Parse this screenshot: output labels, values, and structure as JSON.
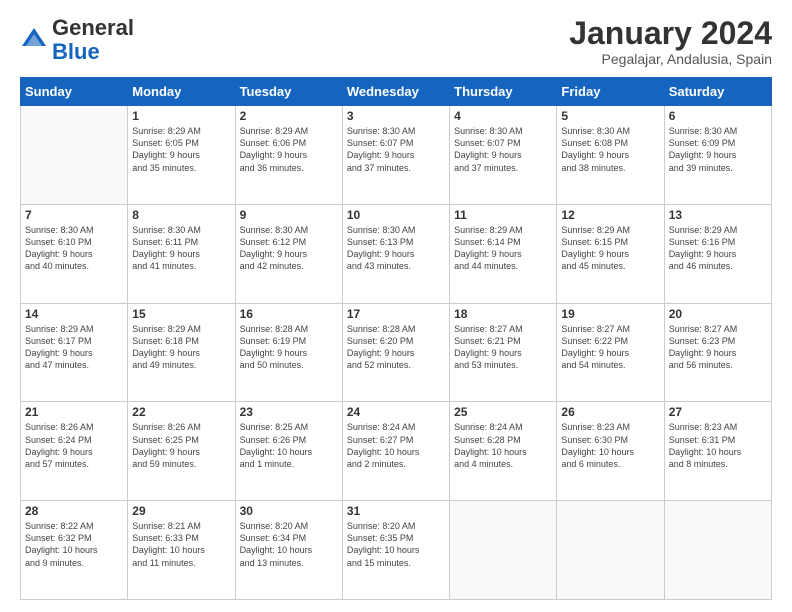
{
  "header": {
    "logo_general": "General",
    "logo_blue": "Blue",
    "month_year": "January 2024",
    "location": "Pegalajar, Andalusia, Spain"
  },
  "weekdays": [
    "Sunday",
    "Monday",
    "Tuesday",
    "Wednesday",
    "Thursday",
    "Friday",
    "Saturday"
  ],
  "weeks": [
    [
      {
        "day": null,
        "info": null
      },
      {
        "day": "1",
        "info": "Sunrise: 8:29 AM\nSunset: 6:05 PM\nDaylight: 9 hours\nand 35 minutes."
      },
      {
        "day": "2",
        "info": "Sunrise: 8:29 AM\nSunset: 6:06 PM\nDaylight: 9 hours\nand 36 minutes."
      },
      {
        "day": "3",
        "info": "Sunrise: 8:30 AM\nSunset: 6:07 PM\nDaylight: 9 hours\nand 37 minutes."
      },
      {
        "day": "4",
        "info": "Sunrise: 8:30 AM\nSunset: 6:07 PM\nDaylight: 9 hours\nand 37 minutes."
      },
      {
        "day": "5",
        "info": "Sunrise: 8:30 AM\nSunset: 6:08 PM\nDaylight: 9 hours\nand 38 minutes."
      },
      {
        "day": "6",
        "info": "Sunrise: 8:30 AM\nSunset: 6:09 PM\nDaylight: 9 hours\nand 39 minutes."
      }
    ],
    [
      {
        "day": "7",
        "info": "Sunrise: 8:30 AM\nSunset: 6:10 PM\nDaylight: 9 hours\nand 40 minutes."
      },
      {
        "day": "8",
        "info": "Sunrise: 8:30 AM\nSunset: 6:11 PM\nDaylight: 9 hours\nand 41 minutes."
      },
      {
        "day": "9",
        "info": "Sunrise: 8:30 AM\nSunset: 6:12 PM\nDaylight: 9 hours\nand 42 minutes."
      },
      {
        "day": "10",
        "info": "Sunrise: 8:30 AM\nSunset: 6:13 PM\nDaylight: 9 hours\nand 43 minutes."
      },
      {
        "day": "11",
        "info": "Sunrise: 8:29 AM\nSunset: 6:14 PM\nDaylight: 9 hours\nand 44 minutes."
      },
      {
        "day": "12",
        "info": "Sunrise: 8:29 AM\nSunset: 6:15 PM\nDaylight: 9 hours\nand 45 minutes."
      },
      {
        "day": "13",
        "info": "Sunrise: 8:29 AM\nSunset: 6:16 PM\nDaylight: 9 hours\nand 46 minutes."
      }
    ],
    [
      {
        "day": "14",
        "info": "Sunrise: 8:29 AM\nSunset: 6:17 PM\nDaylight: 9 hours\nand 47 minutes."
      },
      {
        "day": "15",
        "info": "Sunrise: 8:29 AM\nSunset: 6:18 PM\nDaylight: 9 hours\nand 49 minutes."
      },
      {
        "day": "16",
        "info": "Sunrise: 8:28 AM\nSunset: 6:19 PM\nDaylight: 9 hours\nand 50 minutes."
      },
      {
        "day": "17",
        "info": "Sunrise: 8:28 AM\nSunset: 6:20 PM\nDaylight: 9 hours\nand 52 minutes."
      },
      {
        "day": "18",
        "info": "Sunrise: 8:27 AM\nSunset: 6:21 PM\nDaylight: 9 hours\nand 53 minutes."
      },
      {
        "day": "19",
        "info": "Sunrise: 8:27 AM\nSunset: 6:22 PM\nDaylight: 9 hours\nand 54 minutes."
      },
      {
        "day": "20",
        "info": "Sunrise: 8:27 AM\nSunset: 6:23 PM\nDaylight: 9 hours\nand 56 minutes."
      }
    ],
    [
      {
        "day": "21",
        "info": "Sunrise: 8:26 AM\nSunset: 6:24 PM\nDaylight: 9 hours\nand 57 minutes."
      },
      {
        "day": "22",
        "info": "Sunrise: 8:26 AM\nSunset: 6:25 PM\nDaylight: 9 hours\nand 59 minutes."
      },
      {
        "day": "23",
        "info": "Sunrise: 8:25 AM\nSunset: 6:26 PM\nDaylight: 10 hours\nand 1 minute."
      },
      {
        "day": "24",
        "info": "Sunrise: 8:24 AM\nSunset: 6:27 PM\nDaylight: 10 hours\nand 2 minutes."
      },
      {
        "day": "25",
        "info": "Sunrise: 8:24 AM\nSunset: 6:28 PM\nDaylight: 10 hours\nand 4 minutes."
      },
      {
        "day": "26",
        "info": "Sunrise: 8:23 AM\nSunset: 6:30 PM\nDaylight: 10 hours\nand 6 minutes."
      },
      {
        "day": "27",
        "info": "Sunrise: 8:23 AM\nSunset: 6:31 PM\nDaylight: 10 hours\nand 8 minutes."
      }
    ],
    [
      {
        "day": "28",
        "info": "Sunrise: 8:22 AM\nSunset: 6:32 PM\nDaylight: 10 hours\nand 9 minutes."
      },
      {
        "day": "29",
        "info": "Sunrise: 8:21 AM\nSunset: 6:33 PM\nDaylight: 10 hours\nand 11 minutes."
      },
      {
        "day": "30",
        "info": "Sunrise: 8:20 AM\nSunset: 6:34 PM\nDaylight: 10 hours\nand 13 minutes."
      },
      {
        "day": "31",
        "info": "Sunrise: 8:20 AM\nSunset: 6:35 PM\nDaylight: 10 hours\nand 15 minutes."
      },
      {
        "day": null,
        "info": null
      },
      {
        "day": null,
        "info": null
      },
      {
        "day": null,
        "info": null
      }
    ]
  ]
}
